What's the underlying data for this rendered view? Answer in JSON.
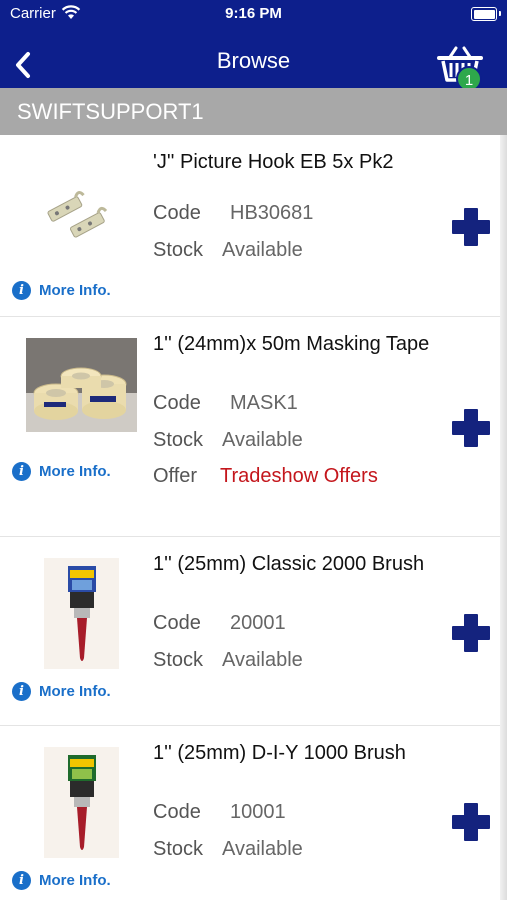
{
  "status": {
    "carrier": "Carrier",
    "time": "9:16 PM"
  },
  "nav": {
    "title": "Browse",
    "basket_count": "1"
  },
  "account": "SWIFTSUPPORT1",
  "labels": {
    "code": "Code",
    "stock": "Stock",
    "offer": "Offer",
    "more_info": "More Info."
  },
  "colors": {
    "navbar": "#0d1f8c",
    "badge": "#2ea84b",
    "offer": "#c4161c",
    "link": "#1a6fc9"
  },
  "products": [
    {
      "title": "'J'' Picture Hook EB 5x Pk2",
      "code": "HB30681",
      "stock": "Available"
    },
    {
      "title": "1'' (24mm)x 50m Masking Tape",
      "code": "MASK1",
      "stock": "Available",
      "offer": "Tradeshow Offers"
    },
    {
      "title": "1'' (25mm) Classic 2000 Brush",
      "code": "20001",
      "stock": "Available"
    },
    {
      "title": "1'' (25mm) D-I-Y 1000 Brush",
      "code": "10001",
      "stock": "Available"
    }
  ]
}
